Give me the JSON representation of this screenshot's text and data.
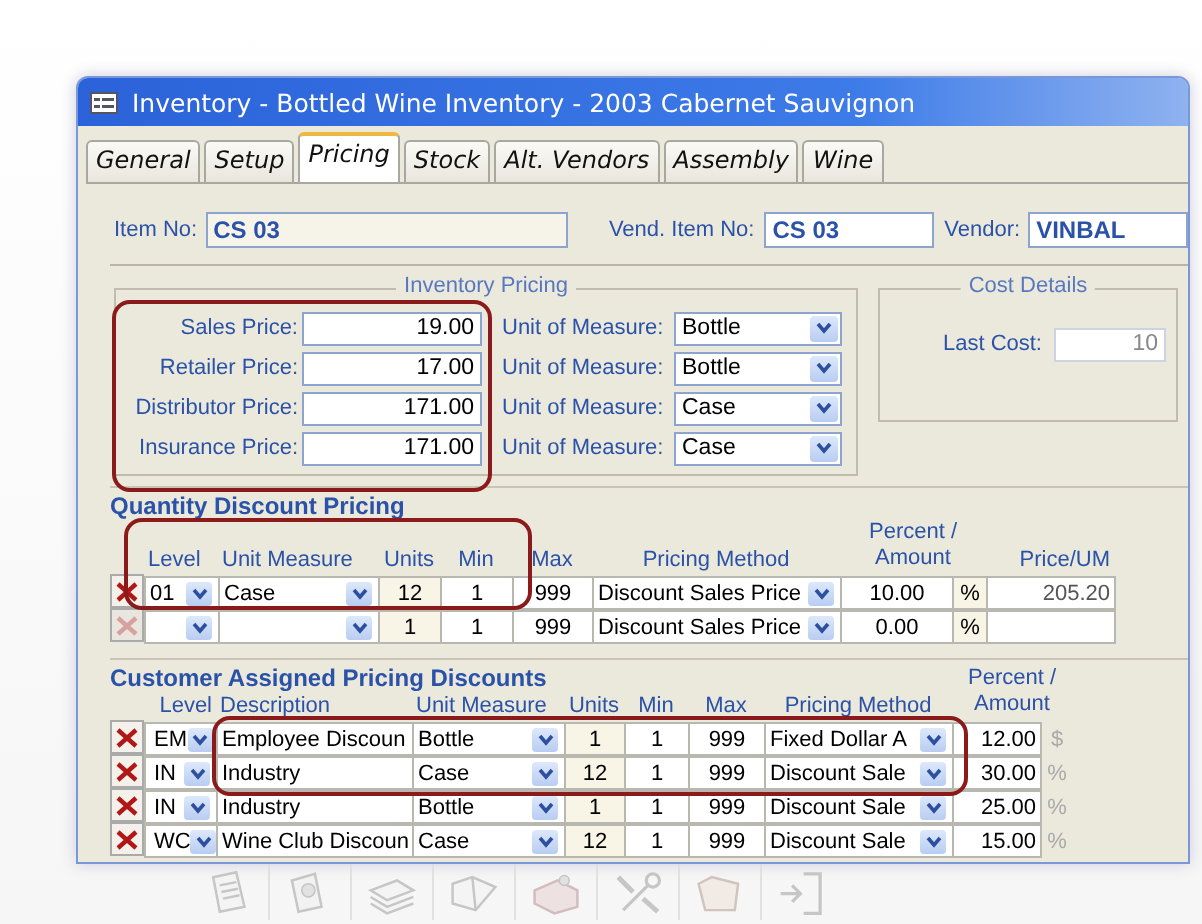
{
  "window": {
    "title": "Inventory - Bottled Wine Inventory - 2003 Cabernet Sauvignon"
  },
  "tabs": [
    {
      "label": "General",
      "selected": false
    },
    {
      "label": "Setup",
      "selected": false
    },
    {
      "label": "Pricing",
      "selected": true
    },
    {
      "label": "Stock",
      "selected": false
    },
    {
      "label": "Alt. Vendors",
      "selected": false
    },
    {
      "label": "Assembly",
      "selected": false
    },
    {
      "label": "Wine",
      "selected": false
    }
  ],
  "header": {
    "item_no": {
      "label": "Item No:",
      "value": "CS 03"
    },
    "vend_item_no": {
      "label": "Vend. Item No:",
      "value": "CS 03"
    },
    "vendor": {
      "label": "Vendor:",
      "value": "VINBAL"
    }
  },
  "inventory_pricing": {
    "title": "Inventory Pricing",
    "rows": [
      {
        "label": "Sales Price:",
        "value": "19.00",
        "uom_label": "Unit of Measure:",
        "uom": "Bottle"
      },
      {
        "label": "Retailer Price:",
        "value": "17.00",
        "uom_label": "Unit of Measure:",
        "uom": "Bottle"
      },
      {
        "label": "Distributor Price:",
        "value": "171.00",
        "uom_label": "Unit of Measure:",
        "uom": "Case"
      },
      {
        "label": "Insurance Price:",
        "value": "171.00",
        "uom_label": "Unit of Measure:",
        "uom": "Case"
      }
    ]
  },
  "cost_details": {
    "title": "Cost Details",
    "label": "Last Cost:",
    "value": "10"
  },
  "quantity_discount": {
    "title": "Quantity Discount Pricing",
    "columns": [
      "Level",
      "Unit Measure",
      "Units",
      "Min",
      "Max",
      "Pricing Method",
      "Percent / Amount",
      "Price/UM"
    ],
    "rows": [
      {
        "kind": "entry",
        "level": "01",
        "unit_measure": "Case",
        "units": "12",
        "min": "1",
        "max": "999",
        "method": "Discount Sales Price",
        "amount": "10.00",
        "type": "%",
        "price": "205.20"
      },
      {
        "kind": "new",
        "units": "1",
        "min": "1",
        "max": "999",
        "method": "Discount Sales Price",
        "amount": "0.00",
        "type": "%"
      }
    ]
  },
  "customer_discounts": {
    "title": "Customer Assigned Pricing Discounts",
    "columns": [
      "Level",
      "Description",
      "Unit Measure",
      "Units",
      "Min",
      "Max",
      "Pricing Method",
      "Percent / Amount"
    ],
    "rows": [
      {
        "level": "EM",
        "description": "Employee Discoun",
        "unit_measure": "Bottle",
        "units": "1",
        "min": "1",
        "max": "999",
        "method": "Fixed Dollar A",
        "amount": "12.00",
        "type": "$"
      },
      {
        "level": "IN",
        "description": "Industry",
        "unit_measure": "Case",
        "units": "12",
        "min": "1",
        "max": "999",
        "method": "Discount Sale",
        "amount": "30.00",
        "type": "%"
      },
      {
        "level": "IN",
        "description": "Industry",
        "unit_measure": "Bottle",
        "units": "1",
        "min": "1",
        "max": "999",
        "method": "Discount Sale",
        "amount": "25.00",
        "type": "%"
      },
      {
        "level": "WC",
        "description": "Wine Club Discoun",
        "unit_measure": "Case",
        "units": "12",
        "min": "1",
        "max": "999",
        "method": "Discount Sale",
        "amount": "15.00",
        "type": "%"
      }
    ]
  }
}
